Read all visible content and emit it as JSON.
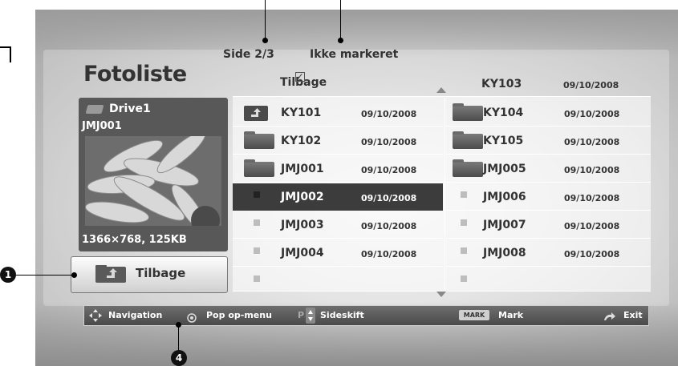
{
  "title": "Fotoliste",
  "page_info": {
    "page": "Side 2/3",
    "marked": "Ikke markeret"
  },
  "preview": {
    "drive": "Drive1",
    "file": "JMJ001",
    "info": "1366×768, 125KB"
  },
  "back_button": {
    "label": "Tilbage"
  },
  "column_header": {
    "left": "Tilbage",
    "right_name": "KY103",
    "right_date": "09/10/2008"
  },
  "left_items": [
    {
      "name": "KY101",
      "date": "09/10/2008"
    },
    {
      "name": "KY102",
      "date": "09/10/2008"
    },
    {
      "name": "JMJ001",
      "date": "09/10/2008"
    },
    {
      "name": "JMJ002",
      "date": "09/10/2008"
    },
    {
      "name": "JMJ003",
      "date": "09/10/2008"
    },
    {
      "name": "JMJ004",
      "date": "09/10/2008"
    }
  ],
  "right_items": [
    {
      "name": "KY104",
      "date": "09/10/2008"
    },
    {
      "name": "KY105",
      "date": "09/10/2008"
    },
    {
      "name": "JMJ005",
      "date": "09/10/2008"
    },
    {
      "name": "JMJ006",
      "date": "09/10/2008"
    },
    {
      "name": "JMJ007",
      "date": "09/10/2008"
    },
    {
      "name": "JMJ008",
      "date": "09/10/2008"
    }
  ],
  "bottom_bar": {
    "navigation": "Navigation",
    "popup": "Pop op-menu",
    "page_key": "P",
    "page_switch": "Sideskift",
    "mark_key": "MARK",
    "mark": "Mark",
    "exit": "Exit"
  },
  "callouts": {
    "one": "1",
    "four": "4"
  },
  "icons": [
    "drive-icon",
    "folder-up-icon",
    "folder-icon",
    "photo-thumb-icon",
    "navigation-arrows-icon",
    "circle-button-icon",
    "exit-arrow-icon",
    "checkbox-icon"
  ]
}
